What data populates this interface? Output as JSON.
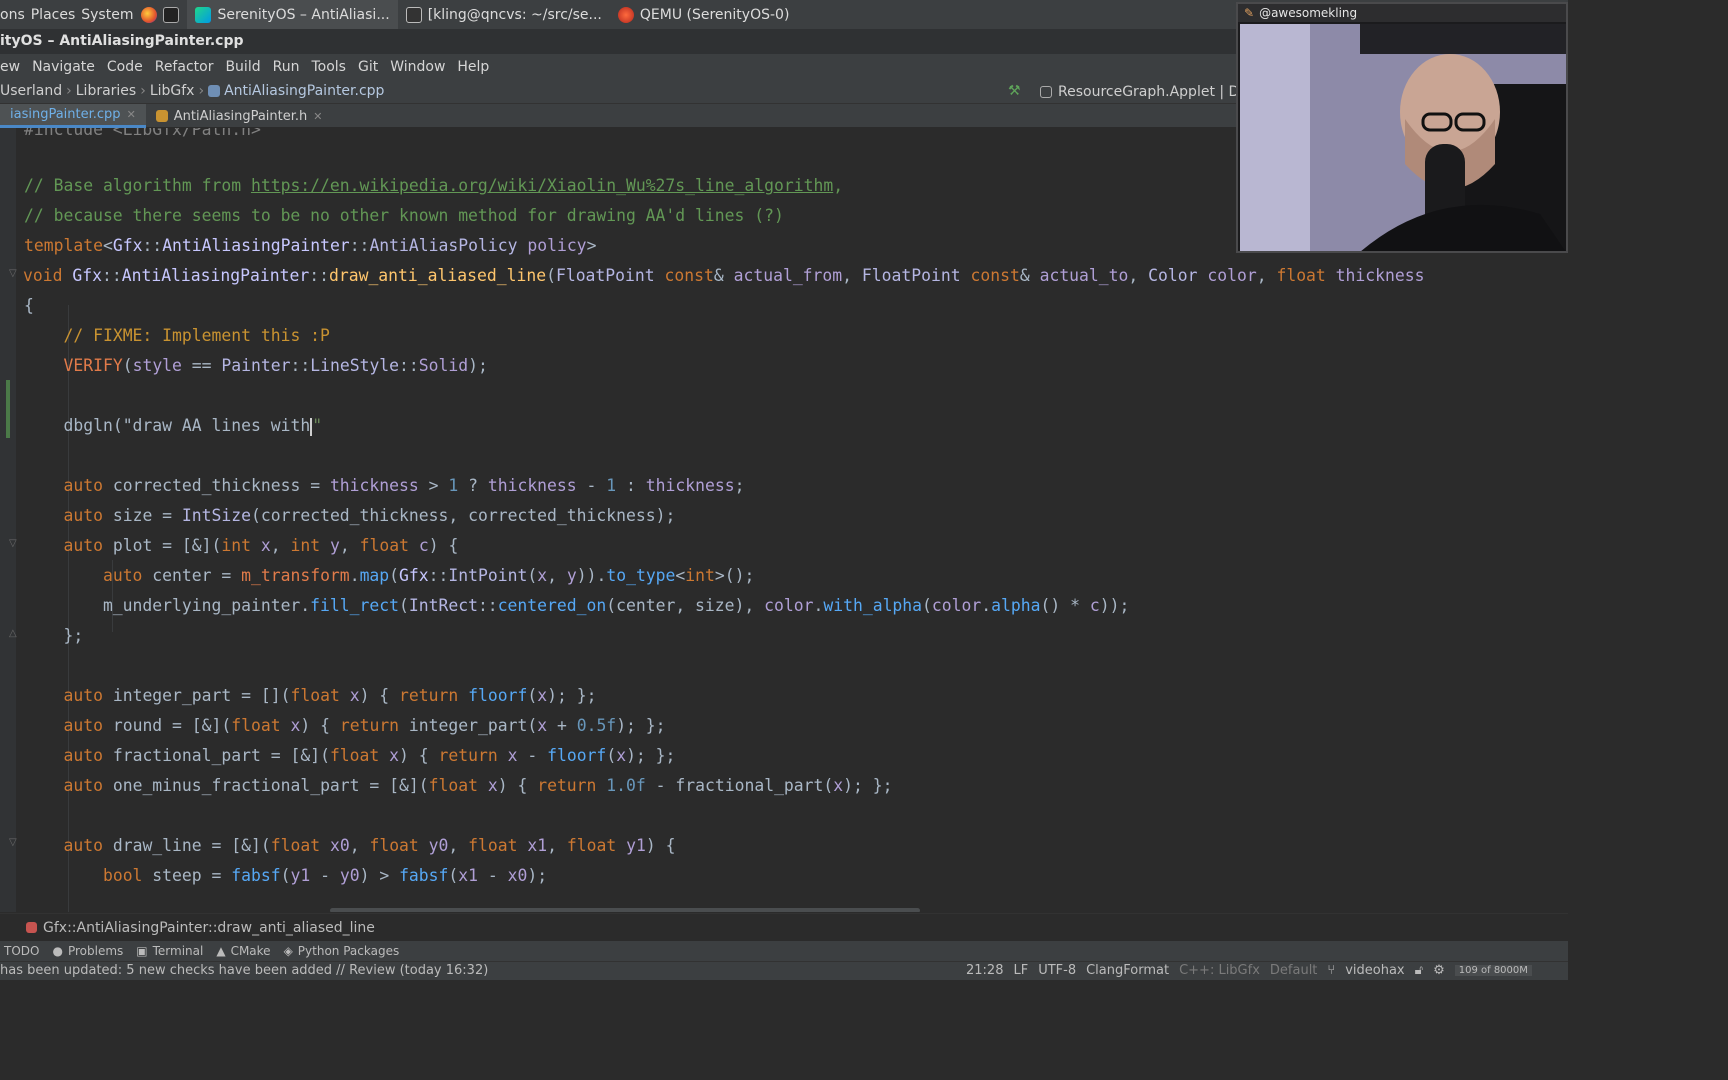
{
  "panel": {
    "menus": [
      "ons",
      "Places",
      "System"
    ],
    "tasks": [
      {
        "icon": "clion-icon",
        "label": "SerenityOS – AntiAliasi...",
        "active": true
      },
      {
        "icon": "terminal-window-icon",
        "label": "[kling@qncvs: ~/src/se..."
      },
      {
        "icon": "qemu-icon",
        "label": "QEMU (SerenityOS-0)"
      }
    ]
  },
  "window": {
    "title": "ityOS – AntiAliasingPainter.cpp"
  },
  "menubar": [
    "ew",
    "Navigate",
    "Code",
    "Refactor",
    "Build",
    "Run",
    "Tools",
    "Git",
    "Window",
    "Help"
  ],
  "navbar": {
    "crumbs": [
      "Userland",
      "Libraries",
      "LibGfx",
      "AntiAliasingPainter.cpp"
    ],
    "run_config": "ResourceGraph.Applet | De"
  },
  "tabs": [
    {
      "label": "iasingPainter.cpp",
      "active": true
    },
    {
      "label": "AntiAliasingPainter.h",
      "active": false
    }
  ],
  "editor": {
    "top_partial": "#include <LibGfx/Path.h>",
    "comment1_prefix": "// Base algorithm from ",
    "comment1_link": "https://en.wikipedia.org/wiki/Xiaolin_Wu%27s_line_algorithm",
    "comment1_suffix": ",",
    "comment2": "// because there seems to be no other known method for drawing AA'd lines (?)",
    "fixme": "// FIXME: Implement this :P",
    "dbgln_text": "dbgln(\"draw AA lines with",
    "dbgln_close": "\""
  },
  "breadcrumb": {
    "label": "Gfx::AntiAliasingPainter::draw_anti_aliased_line"
  },
  "toolwindows": [
    "TODO",
    "Problems",
    "Terminal",
    "CMake",
    "Python Packages"
  ],
  "status": {
    "message": "has been updated: 5 new checks have been added // Review (today 16:32)",
    "position": "21:28",
    "line_sep": "LF",
    "encoding": "UTF-8",
    "formatter": "ClangFormat",
    "context": "C++: LibGfx",
    "profile": "Default",
    "branch": "videohax",
    "memory": "109 of 8000M"
  },
  "webcam": {
    "title": "@awesomekling"
  },
  "colors": {
    "accent": "#4a88c7",
    "keyword": "#cc7832",
    "comment": "#629755",
    "background": "#2b2b2b"
  }
}
